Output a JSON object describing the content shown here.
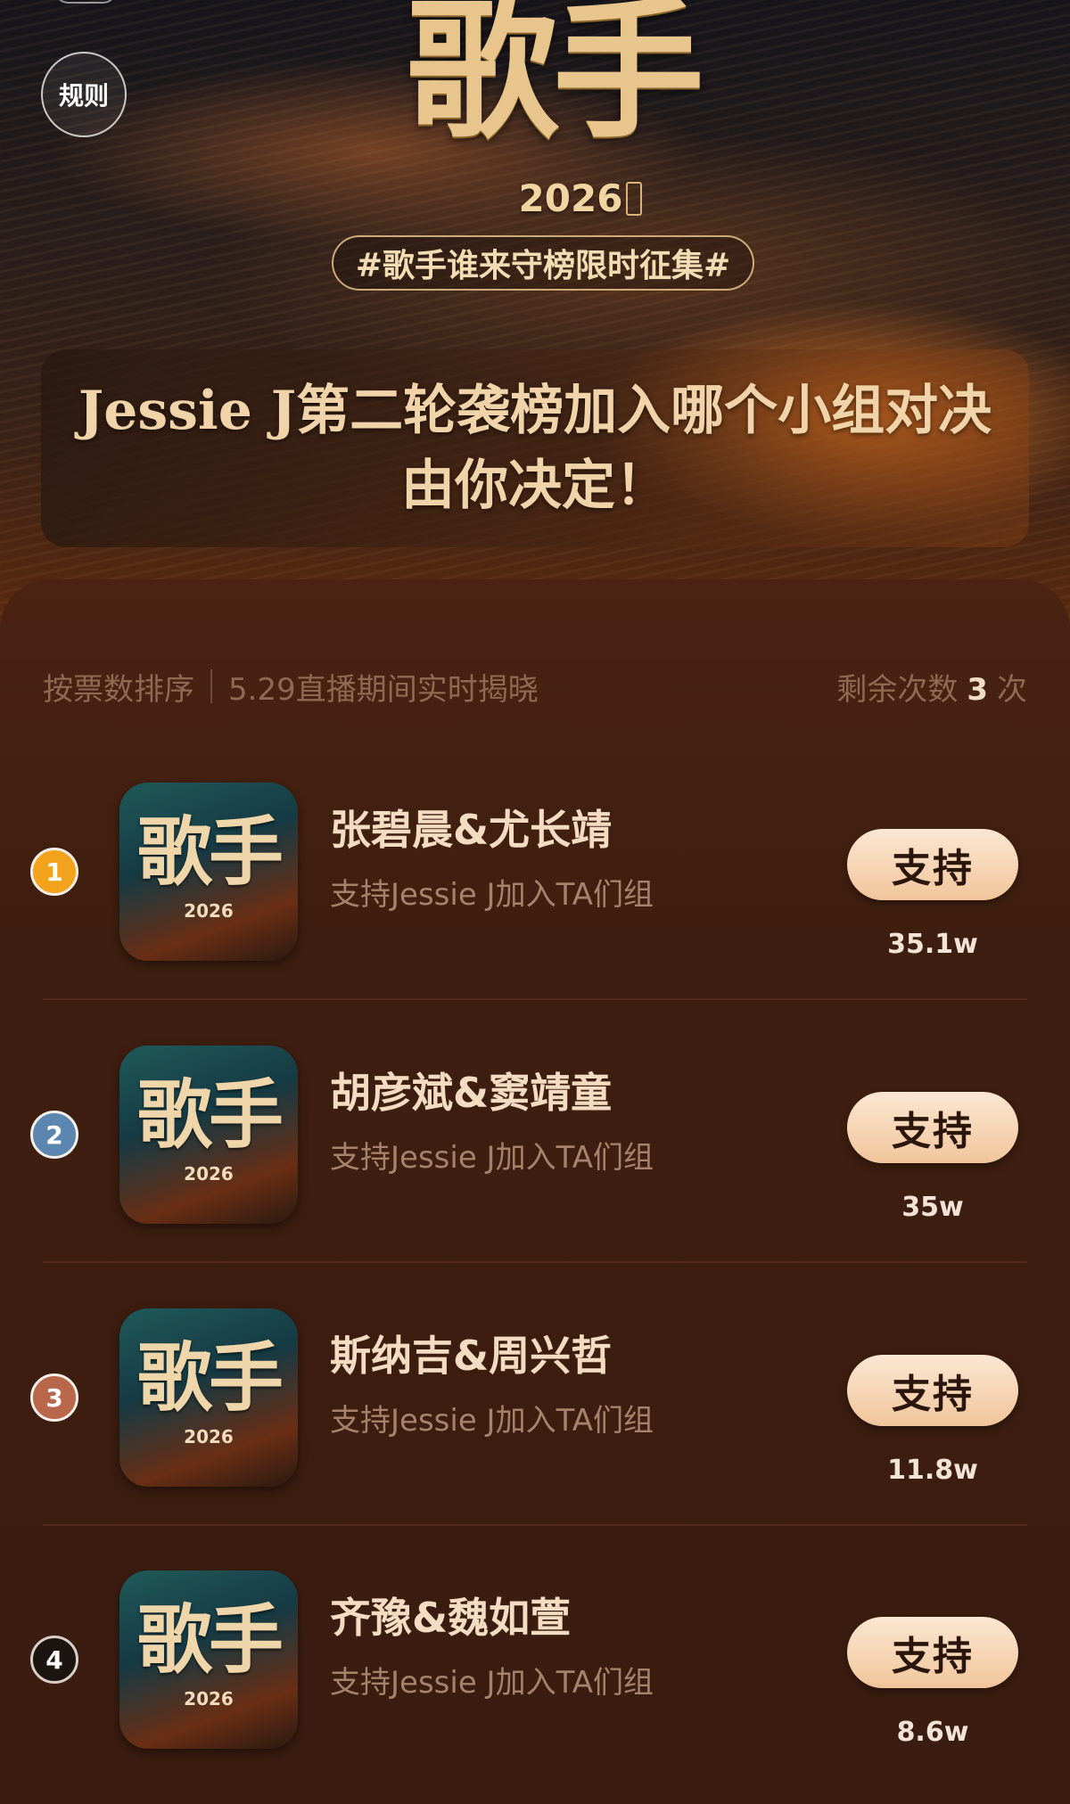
{
  "header": {
    "rules_label": "规则",
    "logo_title": "歌手",
    "logo_year": "2026",
    "hashtag": "#歌手谁来守榜限时征集#",
    "banner_line1": "Jessie J第二轮袭榜加入哪个小组对决",
    "banner_line2": "由你决定！"
  },
  "info": {
    "sort_label": "按票数排序",
    "live_note": "5.29直播期间实时揭晓",
    "remaining_prefix": "剩余次数",
    "remaining_count": "3",
    "remaining_suffix": "次"
  },
  "entries": [
    {
      "rank": "1",
      "thumb_title": "歌手",
      "thumb_year": "2026",
      "names": "张碧晨&尤长靖",
      "subtitle": "支持Jessie J加入TA们组",
      "button": "支持",
      "votes": "35.1w"
    },
    {
      "rank": "2",
      "thumb_title": "歌手",
      "thumb_year": "2026",
      "names": "胡彦斌&窦靖童",
      "subtitle": "支持Jessie J加入TA们组",
      "button": "支持",
      "votes": "35w"
    },
    {
      "rank": "3",
      "thumb_title": "歌手",
      "thumb_year": "2026",
      "names": "斯纳吉&周兴哲",
      "subtitle": "支持Jessie J加入TA们组",
      "button": "支持",
      "votes": "11.8w"
    },
    {
      "rank": "4",
      "thumb_title": "歌手",
      "thumb_year": "2026",
      "names": "齐豫&魏如萱",
      "subtitle": "支持Jessie J加入TA们组",
      "button": "支持",
      "votes": "8.6w"
    }
  ],
  "colors": {
    "panel_bg": "#3b1c10",
    "accent_gold": "#e8c58c",
    "button_bg": "#f1c59b",
    "rank_gold": "#f3a21c",
    "rank_silver": "#5a86b0",
    "rank_bronze": "#b8674a"
  }
}
